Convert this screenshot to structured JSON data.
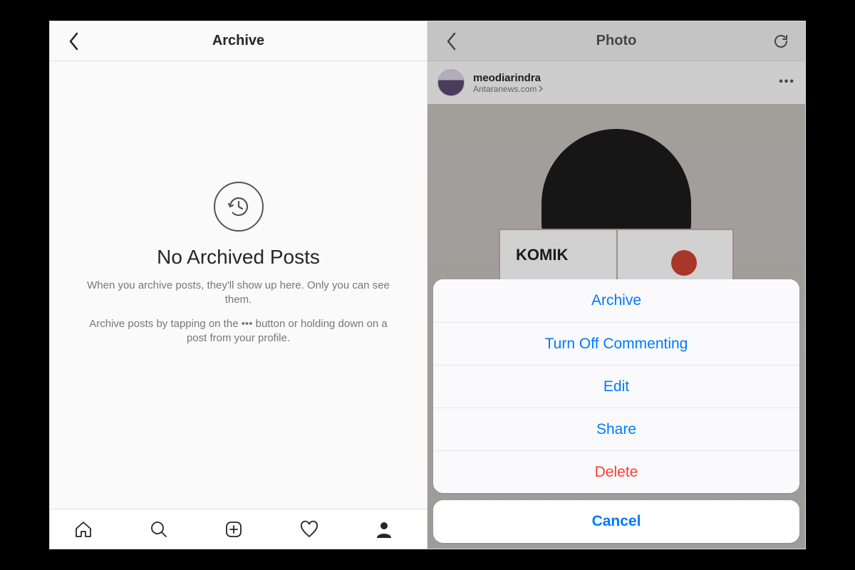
{
  "left": {
    "header": {
      "title": "Archive"
    },
    "empty": {
      "title": "No Archived Posts",
      "line1": "When you archive posts, they'll show up here. Only you can see them.",
      "line2": "Archive posts by tapping on the ••• button or holding down on a post from your profile."
    },
    "tabs": [
      "home",
      "search",
      "add",
      "activity",
      "profile"
    ]
  },
  "right": {
    "header": {
      "title": "Photo"
    },
    "post": {
      "username": "meodiarindra",
      "location": "Antaranews.com",
      "bookTitle": "KOMIK"
    },
    "sheet": {
      "items": [
        {
          "label": "Archive",
          "style": "normal"
        },
        {
          "label": "Turn Off Commenting",
          "style": "normal"
        },
        {
          "label": "Edit",
          "style": "normal"
        },
        {
          "label": "Share",
          "style": "normal"
        },
        {
          "label": "Delete",
          "style": "danger"
        }
      ],
      "cancel": "Cancel"
    }
  },
  "colors": {
    "iosBlue": "#007aff",
    "iosRed": "#ff3b30"
  }
}
